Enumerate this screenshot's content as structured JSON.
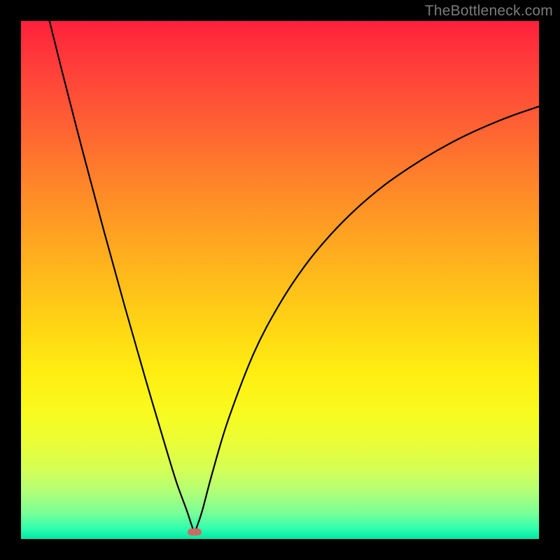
{
  "watermark_text": "TheBottleneck.com",
  "marker": {
    "x_fraction": 0.335,
    "y_fraction": 0.986
  },
  "chart_data": {
    "type": "line",
    "title": "",
    "xlabel": "",
    "ylabel": "",
    "xlim": [
      0,
      1
    ],
    "ylim": [
      0,
      1
    ],
    "grid": false,
    "legend": false,
    "background_gradient": {
      "direction": "vertical",
      "stops": [
        {
          "pos": 0.0,
          "color": "#ff203b"
        },
        {
          "pos": 0.5,
          "color": "#ffca17"
        },
        {
          "pos": 0.8,
          "color": "#f3fc28"
        },
        {
          "pos": 1.0,
          "color": "#00e7a3"
        }
      ]
    },
    "series": [
      {
        "name": "bottleneck-curve",
        "color": "#000000",
        "x": [
          0.055,
          0.08,
          0.12,
          0.16,
          0.2,
          0.24,
          0.28,
          0.3,
          0.32,
          0.33,
          0.335,
          0.34,
          0.35,
          0.37,
          0.4,
          0.45,
          0.5,
          0.55,
          0.6,
          0.65,
          0.7,
          0.75,
          0.8,
          0.85,
          0.9,
          0.95,
          1.0
        ],
        "y": [
          0.0,
          0.1,
          0.255,
          0.405,
          0.55,
          0.69,
          0.825,
          0.89,
          0.945,
          0.975,
          0.986,
          0.975,
          0.945,
          0.87,
          0.77,
          0.64,
          0.545,
          0.47,
          0.41,
          0.36,
          0.318,
          0.283,
          0.252,
          0.225,
          0.202,
          0.182,
          0.165
        ]
      }
    ],
    "annotations": [
      {
        "type": "marker",
        "x": 0.335,
        "y": 0.986,
        "shape": "pill",
        "color": "#cf6a63"
      }
    ]
  }
}
